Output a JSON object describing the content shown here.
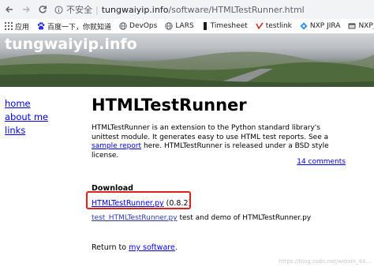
{
  "browser": {
    "security_label": "不安全",
    "separator": "|",
    "url_host": "tungwaiyip.info",
    "url_path": "/software/HTMLTestRunner.html"
  },
  "bookmarks": [
    {
      "label": "应用",
      "icon": "apps-grid-icon",
      "color": "#5f6368"
    },
    {
      "label": "百度一下，你就知道",
      "icon": "baidu-paw-icon",
      "color": "#2932e1"
    },
    {
      "label": "DevOps",
      "icon": "globe-icon",
      "color": "#5f6368"
    },
    {
      "label": "LARS",
      "icon": "globe-icon",
      "color": "#5f6368"
    },
    {
      "label": "Timesheet",
      "icon": "timesheet-icon",
      "color": "#1a1a1a"
    },
    {
      "label": "testlink",
      "icon": "testlink-icon",
      "color": "#c0392b"
    },
    {
      "label": "NXP JIRA",
      "icon": "jira-icon",
      "color": "#2684ff"
    },
    {
      "label": "NXP_PAT",
      "icon": "folder-icon",
      "color": "#333333"
    }
  ],
  "banner": {
    "site_name": "tungwaiyip.info"
  },
  "sidenav": [
    {
      "label": "home"
    },
    {
      "label": "about me"
    },
    {
      "label": "links"
    }
  ],
  "main": {
    "title": "HTMLTestRunner",
    "intro_before_link": "HTMLTestRunner is an extension to the Python standard library's unittest module. It generates easy to use HTML test reports. See a ",
    "sample_report_link": "sample report",
    "intro_after_link": " here. HTMLTestRunner is released under a BSD style license.",
    "comments_link": "14 comments",
    "download_heading": "Download",
    "download_link": "HTMLTestRunner.py",
    "download_version": " (0.8.2)",
    "test_link": "test_HTMLTestRunner.py",
    "test_desc": " test and demo of HTMLTestRunner.py",
    "return_prefix": "Return to ",
    "return_link": "my software",
    "return_suffix": "."
  },
  "watermark": "https://blog.csdn.net/weixin_44...",
  "colors": {
    "link": "#0000ee",
    "highlight": "#e02020"
  }
}
